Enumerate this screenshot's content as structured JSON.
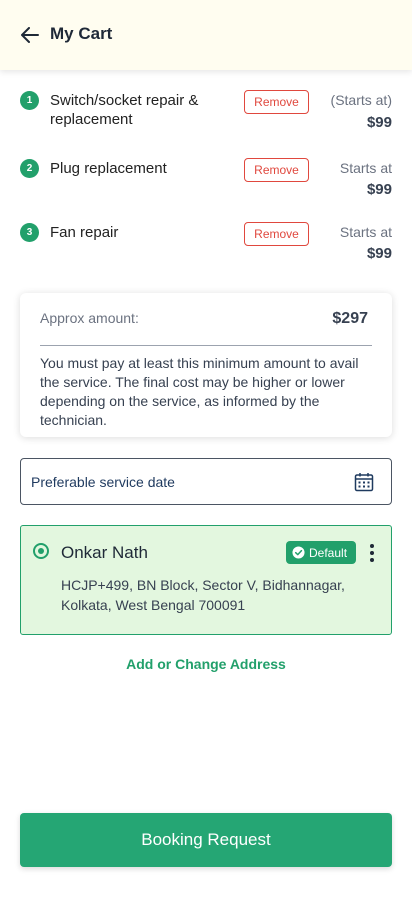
{
  "header": {
    "title": "My Cart"
  },
  "items": [
    {
      "num": "1",
      "name": "Switch/socket repair & replacement",
      "remove_label": "Remove",
      "price_label": "(Starts at)",
      "price": "$99"
    },
    {
      "num": "2",
      "name": "Plug replacement",
      "remove_label": "Remove",
      "price_label": "Starts at",
      "price": "$99"
    },
    {
      "num": "3",
      "name": "Fan repair",
      "remove_label": "Remove",
      "price_label": "Starts at",
      "price": "$99"
    }
  ],
  "summary": {
    "label": "Approx amount:",
    "value": "$297",
    "note": "You must pay at least this minimum amount to avail the service. The final cost may be higher or lower depending on the service, as informed by the technician."
  },
  "date_field": {
    "placeholder": "Preferable service date"
  },
  "address": {
    "name": "Onkar Nath",
    "badge": "Default",
    "line": "HCJP+499, BN Block, Sector V, Bidhannagar, Kolkata, West Bengal 700091"
  },
  "change_address_label": "Add or Change Address",
  "booking_button_label": "Booking Request",
  "colors": {
    "accent": "#22a06b",
    "danger": "#e0483e",
    "header_bg": "#fffdf0",
    "address_bg": "#e3f7df"
  }
}
